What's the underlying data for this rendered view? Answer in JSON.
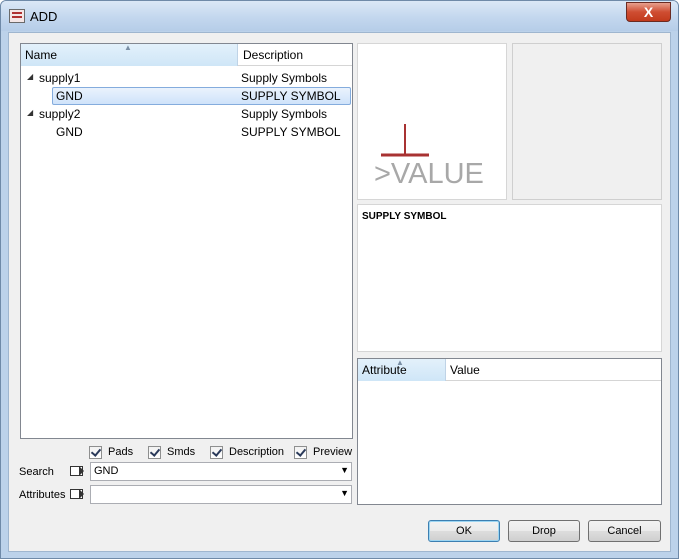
{
  "window": {
    "title": "ADD",
    "close_label": "X"
  },
  "tree": {
    "columns": {
      "name": "Name",
      "description": "Description"
    },
    "rows": [
      {
        "name": "supply1",
        "description": "Supply Symbols",
        "expander": "◢"
      },
      {
        "name": "GND",
        "description": "SUPPLY SYMBOL"
      },
      {
        "name": "supply2",
        "description": "Supply Symbols",
        "expander": "◢"
      },
      {
        "name": "GND",
        "description": "SUPPLY SYMBOL"
      }
    ],
    "sort_indicator": "▲"
  },
  "options": {
    "pads": "Pads",
    "smds": "Smds",
    "description": "Description",
    "preview": "Preview"
  },
  "search": {
    "label": "Search",
    "value": "GND",
    "dropdown": "▼"
  },
  "attributes_filter": {
    "label": "Attributes",
    "value": "",
    "dropdown": "▼"
  },
  "preview": {
    "value_text": ">VALUE",
    "symbol_color": "#a83232"
  },
  "description_panel": {
    "text": "SUPPLY SYMBOL"
  },
  "attr_table": {
    "columns": {
      "attribute": "Attribute",
      "value": "Value"
    }
  },
  "buttons": {
    "ok": "OK",
    "drop": "Drop",
    "cancel": "Cancel"
  }
}
